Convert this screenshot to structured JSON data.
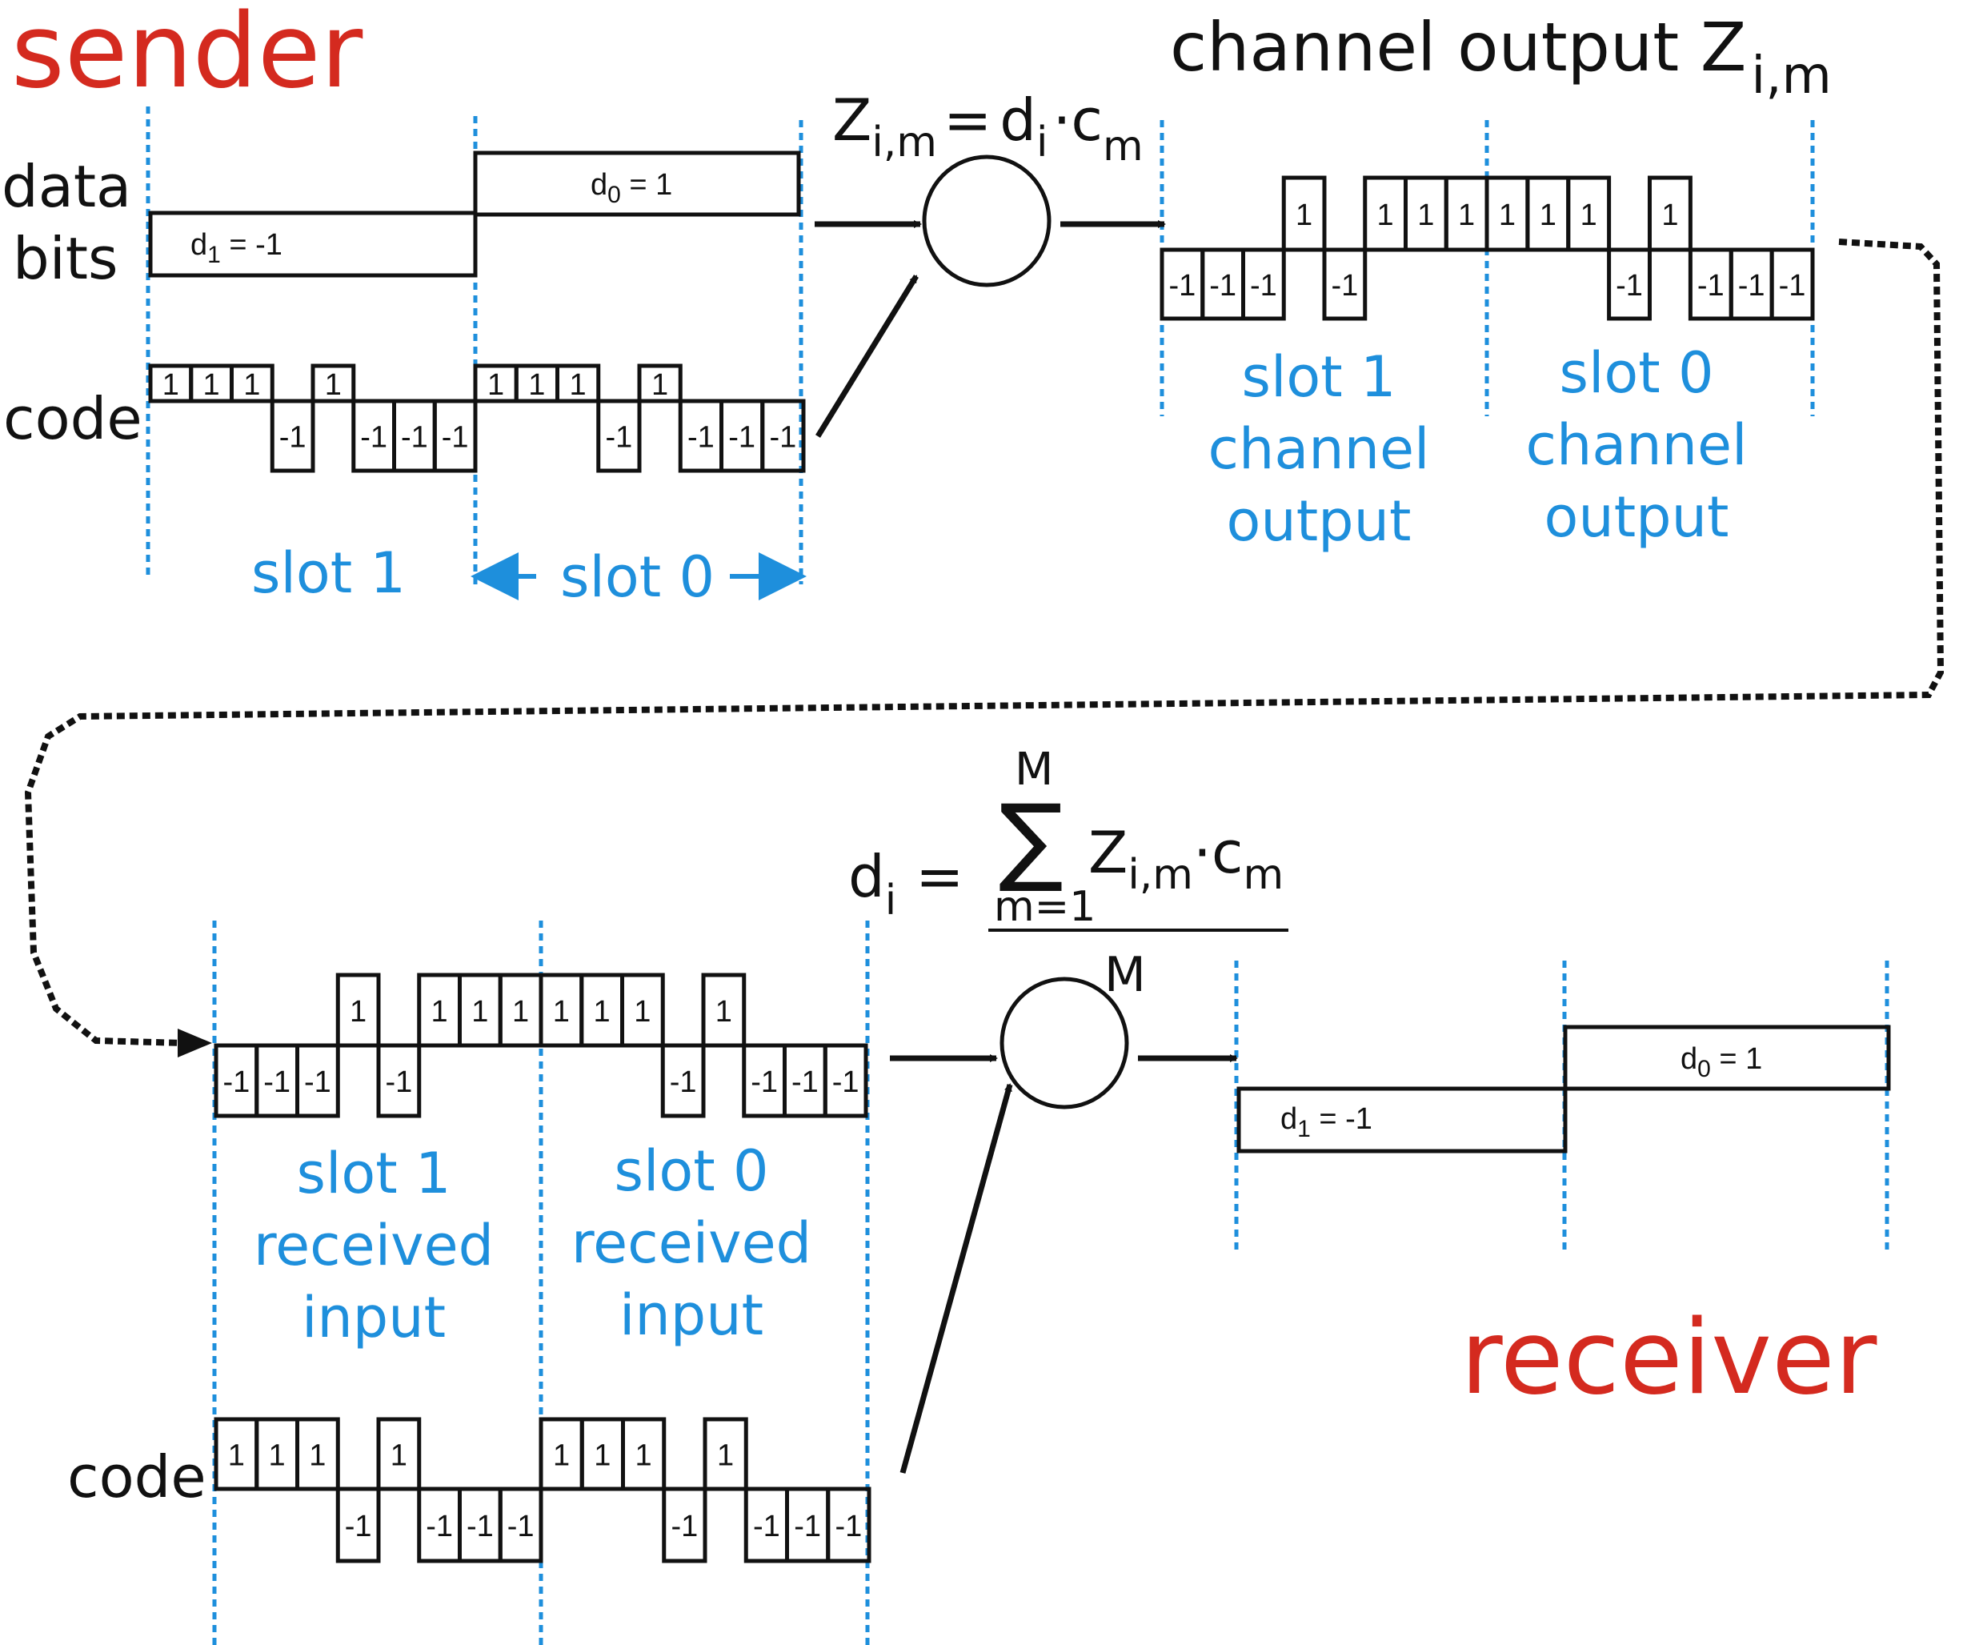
{
  "sender_title": "sender",
  "receiver_title": "receiver",
  "labels": {
    "data_bits_1": "data",
    "data_bits_2": "bits",
    "code": "code",
    "code_receiver": "code"
  },
  "data_bits": {
    "d1": "d1 = -1",
    "d0": "d0 = 1",
    "d1_main": "d",
    "d1_sub": "1",
    "d1_val": " = -1",
    "d0_main": "d",
    "d0_sub": "0",
    "d0_val": " = 1"
  },
  "sender_slot_labels": {
    "slot1": "slot 1",
    "slot0": "slot 0"
  },
  "code_sequence": [
    1,
    1,
    1,
    -1,
    1,
    -1,
    -1,
    -1
  ],
  "data_sequence": {
    "slot1": -1,
    "slot0": 1
  },
  "channel_output": {
    "title": "channel output Z",
    "title_sub": "i,m",
    "slot1_values": [
      -1,
      -1,
      -1,
      1,
      -1,
      1,
      1,
      1
    ],
    "slot0_values": [
      1,
      1,
      1,
      -1,
      1,
      -1,
      -1,
      -1
    ],
    "slot1_label": [
      "slot 1",
      "channel",
      "output"
    ],
    "slot0_label": [
      "slot 0",
      "channel",
      "output"
    ]
  },
  "encode_formula": {
    "Z": "Z",
    "Z_sub": "i,m",
    "eq": "=",
    "d": "d",
    "d_sub": "i",
    "dot": "·",
    "c": "c",
    "c_sub": "m"
  },
  "decode_formula": {
    "d": "d",
    "d_sub": "i",
    "eq": "=",
    "sigma": "∑",
    "upper": "M",
    "lower": "m=1",
    "Z": "Z",
    "Z_sub": "i,m",
    "dot": "·",
    "c": "c",
    "c_sub": "m",
    "denominator": "M"
  },
  "received_input": {
    "slot1_label": [
      "slot 1",
      "received",
      "input"
    ],
    "slot0_label": [
      "slot 0",
      "received",
      "input"
    ]
  },
  "colors": {
    "red": "#d42a1f",
    "blue": "#1e8fdc",
    "black": "#111111"
  }
}
